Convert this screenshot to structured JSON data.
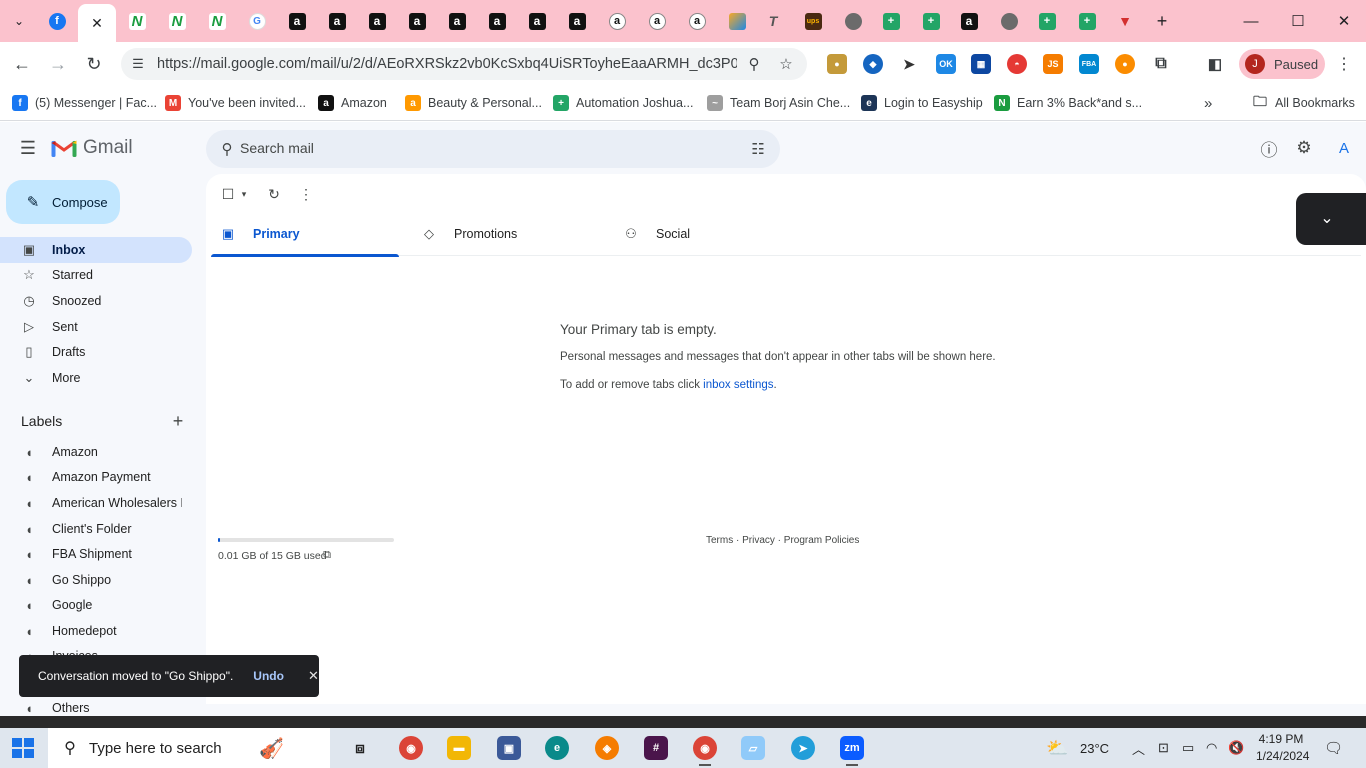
{
  "browser": {
    "tabs": [
      {
        "icon": "facebook-icon",
        "glyph": "f",
        "kind": "fb"
      },
      {
        "icon": "gmail-tab-close-icon",
        "glyph": "✕",
        "kind": "active"
      },
      {
        "icon": "nv-icon",
        "glyph": "N",
        "kind": "nv"
      },
      {
        "icon": "nv-icon",
        "glyph": "N",
        "kind": "nv"
      },
      {
        "icon": "nv-icon",
        "glyph": "N",
        "kind": "nv"
      },
      {
        "icon": "google-icon",
        "glyph": "G",
        "kind": "g"
      },
      {
        "icon": "amazon-icon",
        "glyph": "a",
        "kind": "az"
      },
      {
        "icon": "amazon-icon",
        "glyph": "a",
        "kind": "az"
      },
      {
        "icon": "amazon-icon",
        "glyph": "a",
        "kind": "az"
      },
      {
        "icon": "amazon-icon",
        "glyph": "a",
        "kind": "az"
      },
      {
        "icon": "amazon-icon",
        "glyph": "a",
        "kind": "az"
      },
      {
        "icon": "amazon-icon",
        "glyph": "a",
        "kind": "az"
      },
      {
        "icon": "amazon-icon",
        "glyph": "a",
        "kind": "az"
      },
      {
        "icon": "amazon-icon",
        "glyph": "a",
        "kind": "az"
      },
      {
        "icon": "amazon-smile-icon",
        "glyph": "a",
        "kind": "azs"
      },
      {
        "icon": "amazon-smile-icon",
        "glyph": "a",
        "kind": "azs"
      },
      {
        "icon": "amazon-smile-icon",
        "glyph": "a",
        "kind": "azs"
      },
      {
        "icon": "pen-icon",
        "glyph": "",
        "kind": "pen"
      },
      {
        "icon": "ty-icon",
        "glyph": "T",
        "kind": "ty"
      },
      {
        "icon": "ups-icon",
        "glyph": "ups",
        "kind": "ups"
      },
      {
        "icon": "globe-icon",
        "glyph": "",
        "kind": "glob"
      },
      {
        "icon": "sheets-icon",
        "glyph": "+",
        "kind": "sheet"
      },
      {
        "icon": "sheets-icon",
        "glyph": "+",
        "kind": "sheet"
      },
      {
        "icon": "amazon-icon",
        "glyph": "a",
        "kind": "az"
      },
      {
        "icon": "globe-icon",
        "glyph": "",
        "kind": "glob"
      },
      {
        "icon": "sheets-icon",
        "glyph": "+",
        "kind": "sheet"
      },
      {
        "icon": "sheets-icon",
        "glyph": "+",
        "kind": "sheet"
      },
      {
        "icon": "red-shape-icon",
        "glyph": "▼",
        "kind": "red"
      }
    ],
    "url": "https://mail.google.com/mail/u/2/d/AEoRXRSkz2vb0KcSxbq4UiSRToyheEaaARMH_dc3P0H0...",
    "profile_initial": "J",
    "profile_status": "Paused",
    "bookmarks": [
      {
        "label": "(5) Messenger | Fac...",
        "icon": "facebook-icon",
        "color": "#1877f2",
        "glyph": "f"
      },
      {
        "label": "You've been invited...",
        "icon": "gmail-icon",
        "color": "#ea4335",
        "glyph": "M"
      },
      {
        "label": "Amazon",
        "icon": "amazon-icon",
        "color": "#111111",
        "glyph": "a"
      },
      {
        "label": "Beauty & Personal...",
        "icon": "amazon-smile-icon",
        "color": "#ff9900",
        "glyph": "a"
      },
      {
        "label": "Automation Joshua...",
        "icon": "sheets-icon",
        "color": "#23a566",
        "glyph": "+"
      },
      {
        "label": "Team Borj Asin Che...",
        "icon": "team-icon",
        "color": "#9e9e9e",
        "glyph": "~"
      },
      {
        "label": "Login to Easyship",
        "icon": "easyship-icon",
        "color": "#1d3557",
        "glyph": "e"
      },
      {
        "label": "Earn 3% Back*and s...",
        "icon": "nv-icon",
        "color": "#1a9c3f",
        "glyph": "N"
      }
    ],
    "all_bookmarks": "All Bookmarks"
  },
  "gmail": {
    "product": "Gmail",
    "search_placeholder": "Search mail",
    "compose": "Compose",
    "nav": [
      {
        "label": "Inbox",
        "icon": "inbox-icon",
        "glyph": "▣"
      },
      {
        "label": "Starred",
        "icon": "star-icon",
        "glyph": "☆"
      },
      {
        "label": "Snoozed",
        "icon": "clock-icon",
        "glyph": "◷"
      },
      {
        "label": "Sent",
        "icon": "send-icon",
        "glyph": "▷"
      },
      {
        "label": "Drafts",
        "icon": "draft-icon",
        "glyph": "▯"
      },
      {
        "label": "More",
        "icon": "chevron-down-icon",
        "glyph": "⌄"
      }
    ],
    "labels_title": "Labels",
    "labels": [
      "Amazon",
      "Amazon Payment",
      "American Wholesalers L...",
      "Client's Folder",
      "FBA Shipment",
      "Go Shippo",
      "Google",
      "Homedepot",
      "Invoices",
      "Others"
    ],
    "tabs": [
      {
        "label": "Primary",
        "icon": "inbox-icon",
        "glyph": "▣"
      },
      {
        "label": "Promotions",
        "icon": "tag-icon",
        "glyph": "◇"
      },
      {
        "label": "Social",
        "icon": "people-icon",
        "glyph": "⚇"
      }
    ],
    "empty_title": "Your Primary tab is empty.",
    "empty_desc": "Personal messages and messages that don't appear in other tabs will be shown here.",
    "empty_settings_prefix": "To add or remove tabs click ",
    "empty_settings_link": "inbox settings",
    "empty_settings_suffix": ".",
    "storage": "0.01 GB of 15 GB used",
    "storage_fraction": 0.001,
    "footer": "Terms · Privacy · Program Policies",
    "account_initial": "A",
    "snackbar": {
      "message": "Conversation moved to \"Go Shippo\".",
      "undo": "Undo"
    }
  },
  "taskbar": {
    "search_placeholder": "Type here to search",
    "temperature": "23°C",
    "time": "4:19 PM",
    "date": "1/24/2024"
  }
}
